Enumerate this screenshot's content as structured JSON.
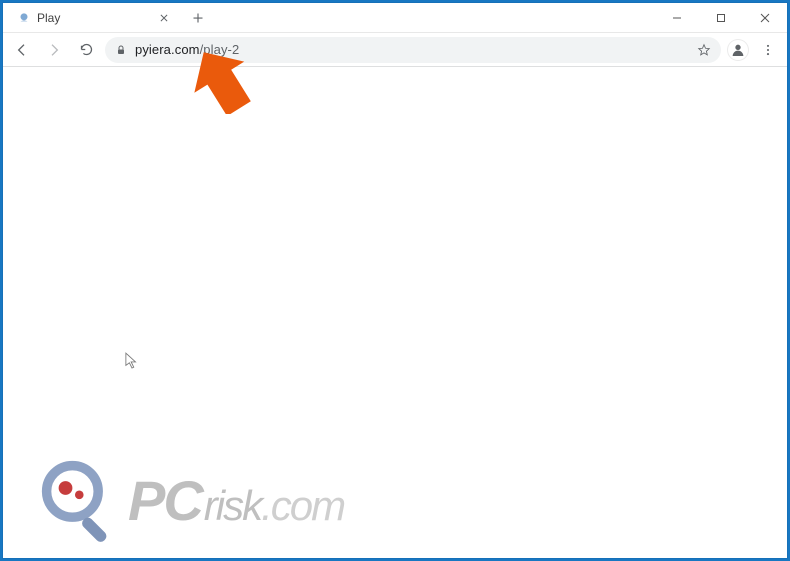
{
  "window": {
    "minimize_tooltip": "Minimize",
    "maximize_tooltip": "Maximize",
    "close_tooltip": "Close"
  },
  "tabs": [
    {
      "title": "Play"
    }
  ],
  "new_tab_tooltip": "New tab",
  "toolbar": {
    "back_tooltip": "Back",
    "forward_tooltip": "Forward",
    "reload_tooltip": "Reload"
  },
  "omnibox": {
    "host": "pyiera.com",
    "path": "/play-2",
    "star_tooltip": "Bookmark this page"
  },
  "profile_tooltip": "You",
  "menu_tooltip": "Customize and control",
  "watermark": {
    "pc": "PC",
    "risk": "risk",
    "dotcom": ".com"
  }
}
